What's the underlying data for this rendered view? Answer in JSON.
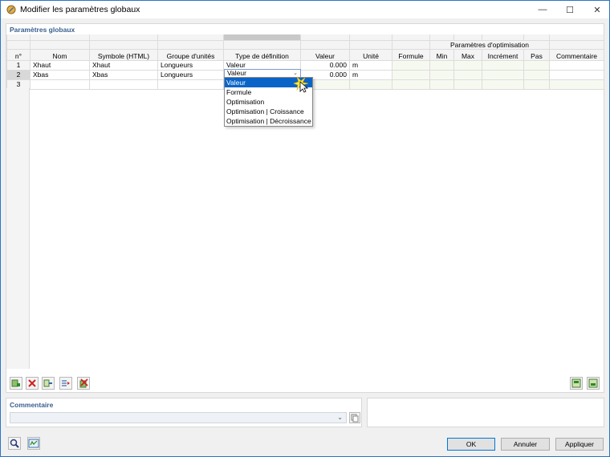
{
  "window": {
    "title": "Modifier les paramètres globaux",
    "minimize": "—",
    "maximize": "☐",
    "close": "✕"
  },
  "panel": {
    "title": "Paramètres globaux"
  },
  "table": {
    "group_header": "Paramètres d'optimisation",
    "columns": [
      "n°",
      "Nom",
      "Symbole (HTML)",
      "Groupe d'unités",
      "Type de définition",
      "Valeur",
      "Unité",
      "Formule",
      "Min",
      "Max",
      "Incrément",
      "Pas",
      "Commentaire"
    ],
    "rows": [
      {
        "n": "1",
        "nom": "Xhaut",
        "symbole": "Xhaut",
        "groupe": "Longueurs",
        "type": "Valeur",
        "valeur": "0.000",
        "unite": "m"
      },
      {
        "n": "2",
        "nom": "Xbas",
        "symbole": "Xbas",
        "groupe": "Longueurs",
        "type": "Valeur",
        "valeur": "0.000",
        "unite": "m"
      },
      {
        "n": "3",
        "nom": "",
        "symbole": "",
        "groupe": "",
        "type": "",
        "valeur": "",
        "unite": ""
      }
    ]
  },
  "dropdown": {
    "selected": "Valeur",
    "options": [
      "Valeur",
      "Formule",
      "Optimisation",
      "Optimisation | Croissance",
      "Optimisation | Décroissance"
    ]
  },
  "comment": {
    "title": "Commentaire",
    "value": ""
  },
  "buttons": {
    "ok": "OK",
    "cancel": "Annuler",
    "apply": "Appliquer"
  }
}
